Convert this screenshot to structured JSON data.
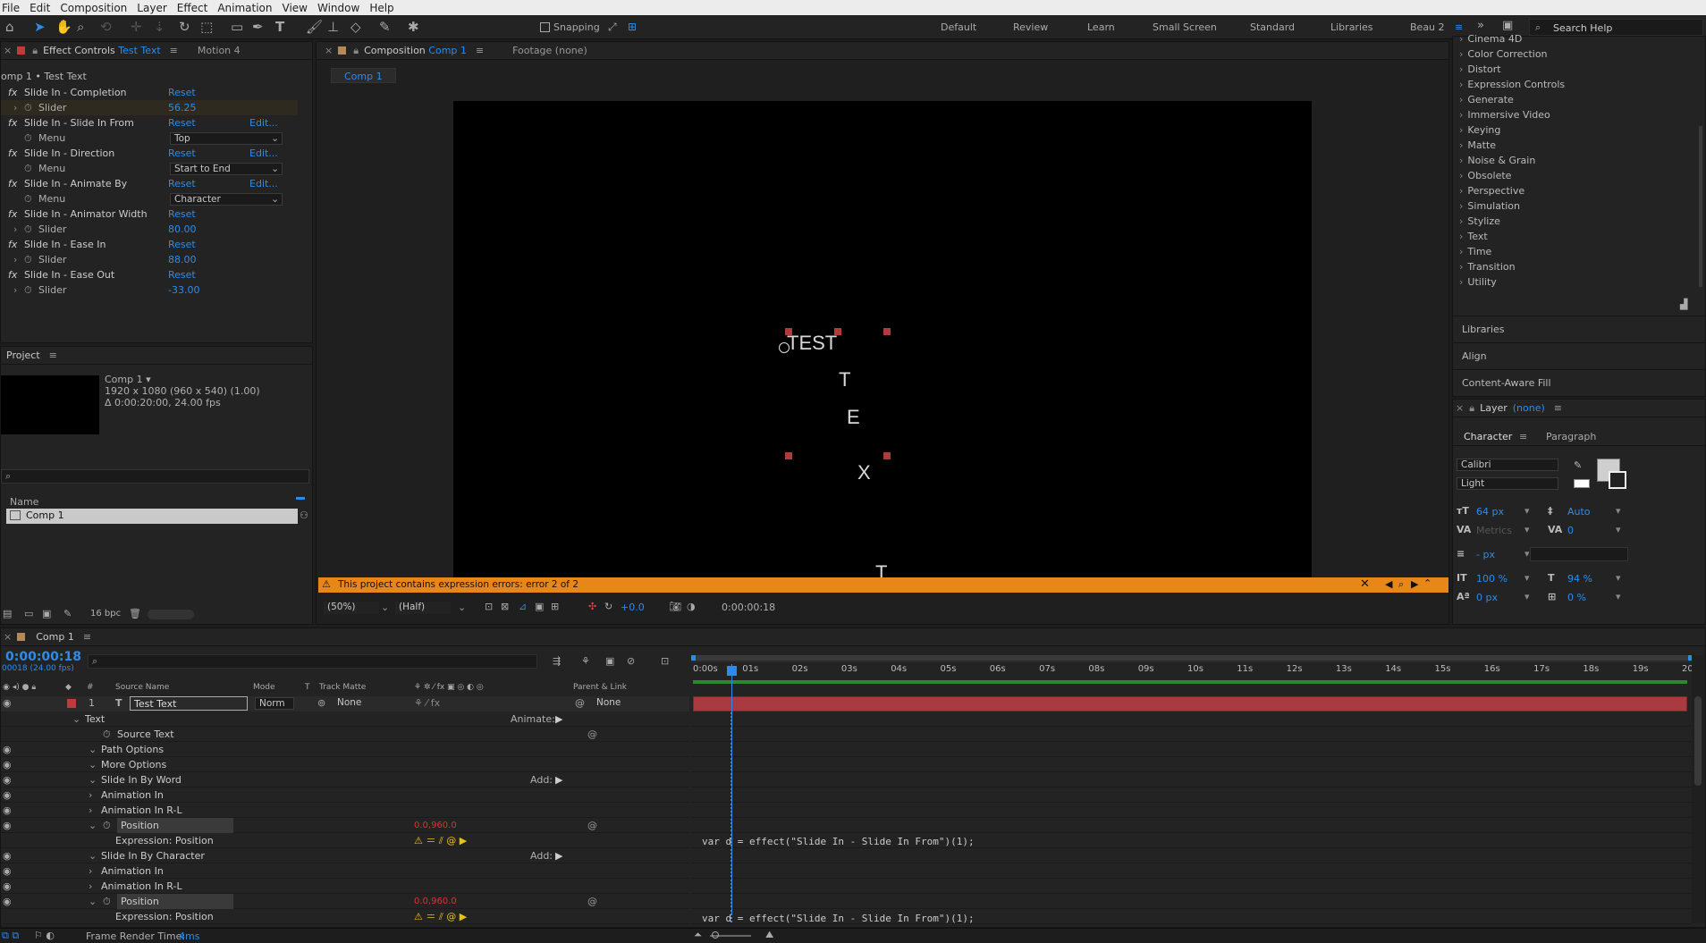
{
  "menu": [
    "File",
    "Edit",
    "Composition",
    "Layer",
    "Effect",
    "Animation",
    "View",
    "Window",
    "Help"
  ],
  "toolbar": {
    "snapping": "Snapping",
    "workspaces": [
      "Default",
      "Review",
      "Learn",
      "Small Screen",
      "Standard",
      "Libraries"
    ],
    "active_workspace": "Beau 2",
    "search_placeholder": "Search Help"
  },
  "effect_controls": {
    "tab_label": "Effect Controls",
    "tab_layer": "Test Text",
    "tab2": "Motion 4",
    "header": "omp 1 • Test Text",
    "rows": [
      {
        "kind": "fx",
        "name": "Slide In - Completion",
        "action": "Reset",
        "edit": ""
      },
      {
        "kind": "param",
        "name": "Slider",
        "value": "56.25"
      },
      {
        "kind": "fx",
        "name": "Slide In - Slide In From",
        "action": "Reset",
        "edit": "Edit..."
      },
      {
        "kind": "menu",
        "name": "Menu",
        "value": "Top"
      },
      {
        "kind": "fx",
        "name": "Slide In - Direction",
        "action": "Reset",
        "edit": "Edit..."
      },
      {
        "kind": "menu",
        "name": "Menu",
        "value": "Start to End"
      },
      {
        "kind": "fx",
        "name": "Slide In - Animate By",
        "action": "Reset",
        "edit": "Edit..."
      },
      {
        "kind": "menu",
        "name": "Menu",
        "value": "Character"
      },
      {
        "kind": "fx",
        "name": "Slide In - Animator Width",
        "action": "Reset",
        "edit": ""
      },
      {
        "kind": "param",
        "name": "Slider",
        "value": "80.00"
      },
      {
        "kind": "fx",
        "name": "Slide In - Ease In",
        "action": "Reset",
        "edit": ""
      },
      {
        "kind": "param",
        "name": "Slider",
        "value": "88.00"
      },
      {
        "kind": "fx",
        "name": "Slide In - Ease Out",
        "action": "Reset",
        "edit": ""
      },
      {
        "kind": "param",
        "name": "Slider",
        "value": "-33.00"
      }
    ]
  },
  "project": {
    "title": "Project",
    "comp_name": "Comp 1 ▾",
    "info1": "1920 x 1080  (960 x 540) (1.00)",
    "info2": "Δ 0:00:20:00, 24.00 fps",
    "col_name": "Name",
    "item": "Comp 1",
    "bpc": "16 bpc"
  },
  "composition": {
    "tab_label": "Composition",
    "tab_comp": "Comp 1",
    "footage": "Footage (none)",
    "breadcrumb": "Comp 1",
    "warning": "This project contains expression errors: error 2 of 2",
    "zoom": "(50%)",
    "resolution": "(Half)",
    "exposure": "+0.0",
    "timecode": "0:00:00:18",
    "canvas_letters": [
      "TEST",
      "T",
      "E",
      "X",
      "T"
    ]
  },
  "effects_list": {
    "categories": [
      "Cinema 4D",
      "Color Correction",
      "Distort",
      "Expression Controls",
      "Generate",
      "Immersive Video",
      "Keying",
      "Matte",
      "Noise & Grain",
      "Obsolete",
      "Perspective",
      "Simulation",
      "Stylize",
      "Text",
      "Time",
      "Transition",
      "Utility"
    ],
    "panels": [
      "Libraries",
      "Align",
      "Content-Aware Fill"
    ]
  },
  "layer_panel": {
    "title": "Layer",
    "value": "(none)"
  },
  "character": {
    "tab": "Character",
    "tab2": "Paragraph",
    "font": "Calibri",
    "style": "Light",
    "size": "64 px",
    "leading": "Auto",
    "kerning": "Metrics",
    "tracking": "0",
    "stroke": "- px",
    "vscale": "100 %",
    "hscale": "94 %",
    "baseline": "0 px",
    "tsume": "0 %"
  },
  "timeline": {
    "tab": "Comp 1",
    "timecode": "0:00:00:18",
    "fps": "00018 (24.00 fps)",
    "columns": {
      "source": "Source Name",
      "mode": "Mode",
      "t": "T",
      "matte": "Track Matte",
      "parent": "Parent & Link"
    },
    "layer": {
      "num": "1",
      "name": "Test Text",
      "mode": "Norm",
      "matte": "None",
      "parent": "None"
    },
    "rows": [
      {
        "indent": 1,
        "label": "Text",
        "right": "Animate:"
      },
      {
        "indent": 2,
        "label": "Source Text",
        "right": ""
      },
      {
        "indent": 2,
        "label": "Path Options",
        "right": ""
      },
      {
        "indent": 2,
        "label": "More Options",
        "right": ""
      },
      {
        "indent": 2,
        "label": "Slide In By Word",
        "right": "Add:"
      },
      {
        "indent": 3,
        "label": "Animation In",
        "right": ""
      },
      {
        "indent": 3,
        "label": "Animation In R-L",
        "right": ""
      },
      {
        "indent": 3,
        "label": "Position",
        "value": "0.0,960.0"
      },
      {
        "indent": 4,
        "label": "Expression: Position",
        "right": ""
      },
      {
        "indent": 2,
        "label": "Slide In By Character",
        "right": "Add:"
      },
      {
        "indent": 3,
        "label": "Animation In",
        "right": ""
      },
      {
        "indent": 3,
        "label": "Animation In R-L",
        "right": ""
      },
      {
        "indent": 3,
        "label": "Position",
        "value": "0.0,960.0"
      },
      {
        "indent": 4,
        "label": "Expression: Position",
        "right": ""
      }
    ],
    "ticks": [
      "0:00s",
      "01s",
      "02s",
      "03s",
      "04s",
      "05s",
      "06s",
      "07s",
      "08s",
      "09s",
      "10s",
      "11s",
      "12s",
      "13s",
      "14s",
      "15s",
      "16s",
      "17s",
      "18s",
      "19s",
      "20s"
    ],
    "expression": "var d = effect(\"Slide In - Slide In From\")(1);",
    "render_label": "Frame Render Time:",
    "render_value": "4ms"
  },
  "colors": {
    "accent": "#2d8ceb",
    "warning": "#e8861a",
    "layer_bar": "#a93a3f",
    "workarea": "#2b8b2b"
  }
}
